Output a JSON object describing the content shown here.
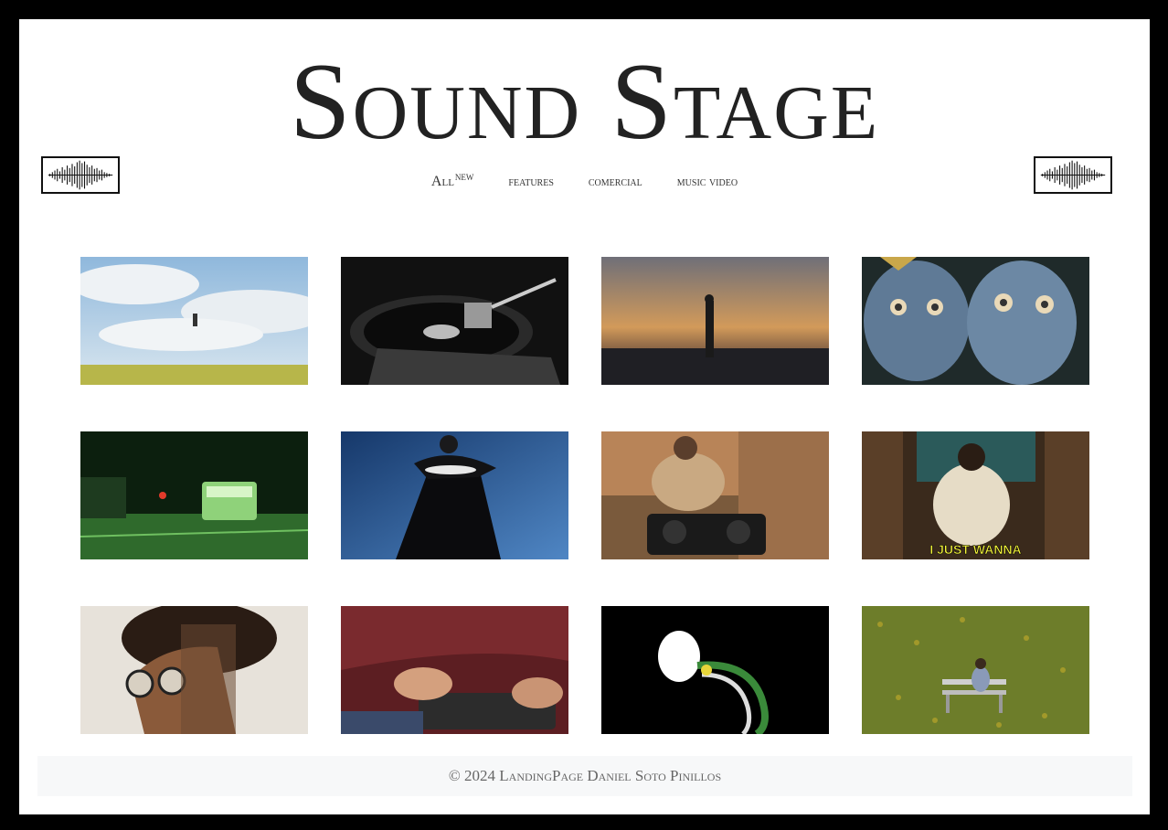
{
  "site": {
    "title": "Sound Stage"
  },
  "nav": {
    "items": [
      {
        "label": "All",
        "badge": "NEW"
      },
      {
        "label": "FEATURES"
      },
      {
        "label": "COMERCIAL"
      },
      {
        "label": "MUSIC VIDEO"
      }
    ]
  },
  "thumbnails": [
    {
      "caption": ""
    },
    {
      "caption": ""
    },
    {
      "caption": ""
    },
    {
      "caption": ""
    },
    {
      "caption": ""
    },
    {
      "caption": ""
    },
    {
      "caption": ""
    },
    {
      "caption": "I JUST WANNA"
    },
    {
      "caption": ""
    },
    {
      "caption": ""
    },
    {
      "caption": ""
    },
    {
      "caption": ""
    }
  ],
  "footer": {
    "text": "© 2024 LandingPage Daniel Soto Pinillos"
  },
  "colors": {
    "frame": "#000000",
    "page": "#ffffff",
    "title": "#222222",
    "footer_bg": "#f7f8f9"
  }
}
